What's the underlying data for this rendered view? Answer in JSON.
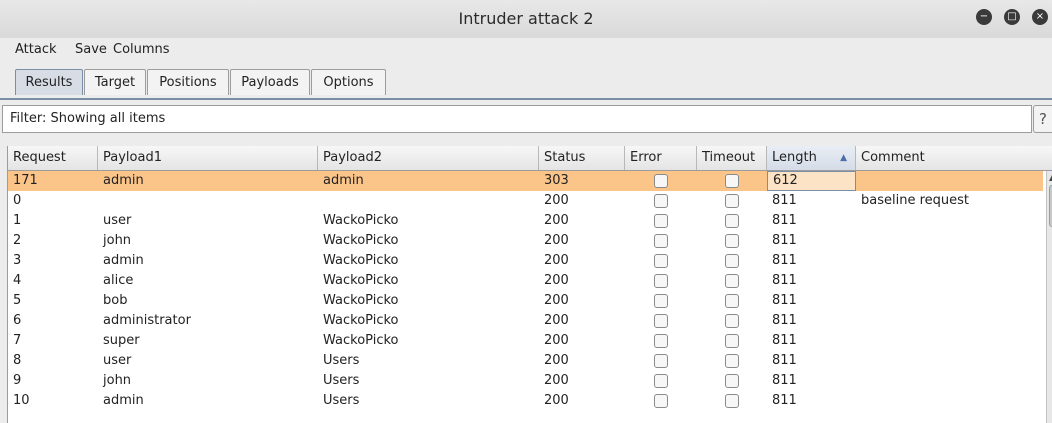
{
  "window": {
    "title": "Intruder attack 2"
  },
  "menu": [
    "Attack",
    "Save",
    "Columns"
  ],
  "tabs": [
    "Results",
    "Target",
    "Positions",
    "Payloads",
    "Options"
  ],
  "filter": {
    "text": "Filter: Showing all items",
    "help": "?"
  },
  "table": {
    "columns": [
      "Request",
      "Payload1",
      "Payload2",
      "Status",
      "Error",
      "Timeout",
      "Length",
      "Comment"
    ],
    "sorted_column": "Length",
    "rows": [
      {
        "request": "171",
        "payload1": "admin",
        "payload2": "admin",
        "status": "303",
        "length": "612",
        "comment": ""
      },
      {
        "request": "0",
        "payload1": "",
        "payload2": "",
        "status": "200",
        "length": "811",
        "comment": "baseline request"
      },
      {
        "request": "1",
        "payload1": "user",
        "payload2": "WackoPicko",
        "status": "200",
        "length": "811",
        "comment": ""
      },
      {
        "request": "2",
        "payload1": "john",
        "payload2": "WackoPicko",
        "status": "200",
        "length": "811",
        "comment": ""
      },
      {
        "request": "3",
        "payload1": "admin",
        "payload2": "WackoPicko",
        "status": "200",
        "length": "811",
        "comment": ""
      },
      {
        "request": "4",
        "payload1": "alice",
        "payload2": "WackoPicko",
        "status": "200",
        "length": "811",
        "comment": ""
      },
      {
        "request": "5",
        "payload1": "bob",
        "payload2": "WackoPicko",
        "status": "200",
        "length": "811",
        "comment": ""
      },
      {
        "request": "6",
        "payload1": "administrator",
        "payload2": "WackoPicko",
        "status": "200",
        "length": "811",
        "comment": ""
      },
      {
        "request": "7",
        "payload1": "super",
        "payload2": "WackoPicko",
        "status": "200",
        "length": "811",
        "comment": ""
      },
      {
        "request": "8",
        "payload1": "user",
        "payload2": "Users",
        "status": "200",
        "length": "811",
        "comment": ""
      },
      {
        "request": "9",
        "payload1": "john",
        "payload2": "Users",
        "status": "200",
        "length": "811",
        "comment": ""
      },
      {
        "request": "10",
        "payload1": "admin",
        "payload2": "Users",
        "status": "200",
        "length": "811",
        "comment": ""
      }
    ]
  },
  "colors": {
    "selected_row": "#fbc58a",
    "accent": "#7a8ea8"
  }
}
